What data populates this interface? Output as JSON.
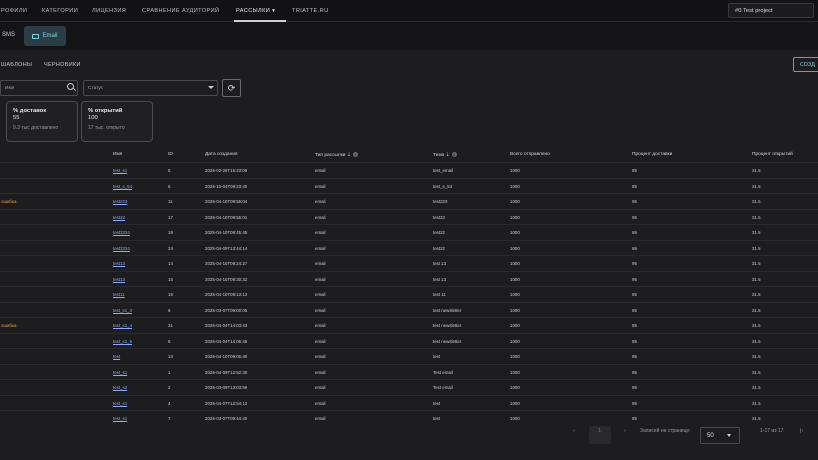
{
  "nav": {
    "items": [
      "РОФИЛИ",
      "КАТЕГОРИИ",
      "ЛИЦЕНЗИЯ",
      "СРАВНЕНИЕ АУДИТОРИЙ",
      "РАССЫЛКИ",
      "TRIATTE.RU"
    ],
    "project": "#0 Test project"
  },
  "subtabs": {
    "sms": "SMS",
    "email": "Email"
  },
  "content_tabs": {
    "templates": "ШАБЛОНЫ",
    "drafts": "ЧЕРНОВИКИ",
    "create": "СОЗД"
  },
  "filters": {
    "search_value": "Имя",
    "status_value": "Статус"
  },
  "cards": [
    {
      "title": "% доставок",
      "value": "55",
      "sub": "9.3 тыс доставлено"
    },
    {
      "title": "% открытий",
      "value": "100",
      "sub": "17 тыс. открыто"
    }
  ],
  "table": {
    "headers": [
      "Имя",
      "ID",
      "Дата создания",
      "Тип рассылки",
      "Тема",
      "Всего отправлено",
      "Процент доставки",
      "Процент открытий"
    ],
    "rows": [
      {
        "status": "",
        "name": "test_s1",
        "id": "5",
        "date": "2025-02-26T15:23:06",
        "type": "email",
        "subject": "test_email",
        "sent": "1000",
        "delivery": "95",
        "open": "31.5"
      },
      {
        "status": "",
        "name": "test_s_54",
        "id": "6",
        "date": "2025-10-04T09:23:40",
        "type": "email",
        "subject": "test_s_54",
        "sent": "1000",
        "delivery": "95",
        "open": "31.5"
      },
      {
        "status": "ошибка",
        "name": "test223",
        "id": "11",
        "date": "2025-04-10T09:55:04",
        "type": "email",
        "subject": "test223",
        "sent": "1000",
        "delivery": "95",
        "open": "31.5"
      },
      {
        "status": "",
        "name": "test22",
        "id": "17",
        "date": "2025-04-10T09:55:01",
        "type": "email",
        "subject": "test22",
        "sent": "1000",
        "delivery": "95",
        "open": "31.5"
      },
      {
        "status": "",
        "name": "test2224",
        "id": "19",
        "date": "2025-04-10T09:45:45",
        "type": "email",
        "subject": "test22",
        "sent": "1000",
        "delivery": "95",
        "open": "31.5"
      },
      {
        "status": "",
        "name": "test2224",
        "id": "24",
        "date": "2025-04-09T13:44:14",
        "type": "email",
        "subject": "test22",
        "sent": "1000",
        "delivery": "95",
        "open": "31.5"
      },
      {
        "status": "",
        "name": "test13",
        "id": "14",
        "date": "2025-04-10T09:24:27",
        "type": "email",
        "subject": "test 13",
        "sent": "1000",
        "delivery": "95",
        "open": "31.5"
      },
      {
        "status": "",
        "name": "test13",
        "id": "15",
        "date": "2025-04-10T09:30:32",
        "type": "email",
        "subject": "test 13",
        "sent": "1000",
        "delivery": "95",
        "open": "31.5"
      },
      {
        "status": "",
        "name": "test11",
        "id": "16",
        "date": "2025-04-10T09:13:13",
        "type": "email",
        "subject": "test 11",
        "sent": "1000",
        "delivery": "95",
        "open": "31.5"
      },
      {
        "status": "",
        "name": "test_s1_3",
        "id": "6",
        "date": "2025-03-07T09:00:05",
        "type": "email",
        "subject": "test newsletter",
        "sent": "1000",
        "delivery": "95",
        "open": "31.5"
      },
      {
        "status": "ошибка",
        "name": "test_s1_4",
        "id": "31",
        "date": "2025-04-04T14:03:43",
        "type": "email",
        "subject": "test newsletter",
        "sent": "1000",
        "delivery": "95",
        "open": "31.5"
      },
      {
        "status": "",
        "name": "test_s1_5",
        "id": "8",
        "date": "2025-04-04T14:05:45",
        "type": "email",
        "subject": "test newsletter",
        "sent": "1000",
        "delivery": "95",
        "open": "31.5"
      },
      {
        "status": "",
        "name": "test",
        "id": "13",
        "date": "2025-04-10T09:05:40",
        "type": "email",
        "subject": "test",
        "sent": "1000",
        "delivery": "95",
        "open": "31.5"
      },
      {
        "status": "",
        "name": "test_s1",
        "id": "1",
        "date": "2025-04-09T12:52:30",
        "type": "email",
        "subject": "Test email",
        "sent": "1000",
        "delivery": "95",
        "open": "31.5"
      },
      {
        "status": "",
        "name": "test_s2",
        "id": "2",
        "date": "2025-03-09T13:03:59",
        "type": "email",
        "subject": "Test email",
        "sent": "1000",
        "delivery": "95",
        "open": "31.5"
      },
      {
        "status": "",
        "name": "test_s1",
        "id": "4",
        "date": "2025-04-07T12:54:13",
        "type": "email",
        "subject": "test",
        "sent": "1000",
        "delivery": "95",
        "open": "31.5"
      },
      {
        "status": "",
        "name": "test_s1",
        "id": "7",
        "date": "2025-03-07T09:44:40",
        "type": "email",
        "subject": "test",
        "sent": "1000",
        "delivery": "95",
        "open": "31.5"
      }
    ]
  },
  "pagination": {
    "page": "1",
    "per_page_label": "Записей на странице:",
    "per_page": "50",
    "range": "1-17 из 17"
  }
}
